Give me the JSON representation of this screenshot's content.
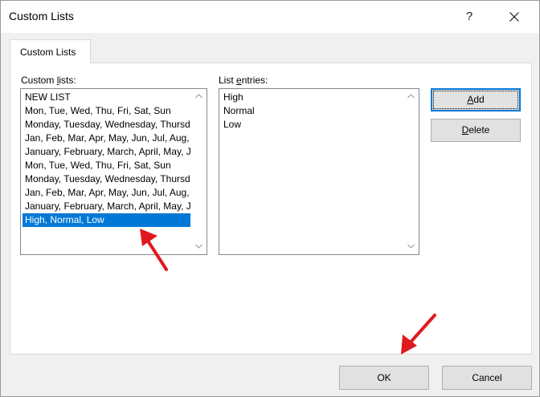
{
  "window": {
    "title": "Custom Lists",
    "help_glyph": "?",
    "close_icon": "close-icon"
  },
  "tabs": [
    {
      "label": "Custom Lists",
      "active": true
    }
  ],
  "custom_lists": {
    "label_prefix": "Custom ",
    "label_mnemonic": "l",
    "label_suffix": "ists:",
    "items": [
      "NEW LIST",
      "Mon, Tue, Wed, Thu, Fri, Sat, Sun",
      "Monday, Tuesday, Wednesday, Thursday, Friday, Saturday, Sunday",
      "Jan, Feb, Mar, Apr, May, Jun, Jul, Aug, Sep, Oct, Nov, Dec",
      "January, February, March, April, May, June, July, August, September, October, November, December",
      "Mon, Tue, Wed, Thu, Fri, Sat, Sun",
      "Monday, Tuesday, Wednesday, Thursday, Friday, Saturday, Sunday",
      "Jan, Feb, Mar, Apr, May, Jun, Jul, Aug, Sep, Oct, Nov, Dec",
      "January, February, March, April, May, June, July, August, September, October, November, December",
      "High, Normal, Low"
    ],
    "selected_index": 9
  },
  "list_entries": {
    "label_prefix": "List ",
    "label_mnemonic": "e",
    "label_suffix": "ntries:",
    "lines": [
      "High",
      "Normal",
      "Low"
    ]
  },
  "buttons": {
    "add": {
      "mnemonic": "A",
      "rest": "dd"
    },
    "delete": {
      "mnemonic": "D",
      "rest": "elete"
    },
    "ok": "OK",
    "cancel": "Cancel"
  },
  "colors": {
    "selection": "#0078d7",
    "annotation_arrow": "#e0191e"
  }
}
